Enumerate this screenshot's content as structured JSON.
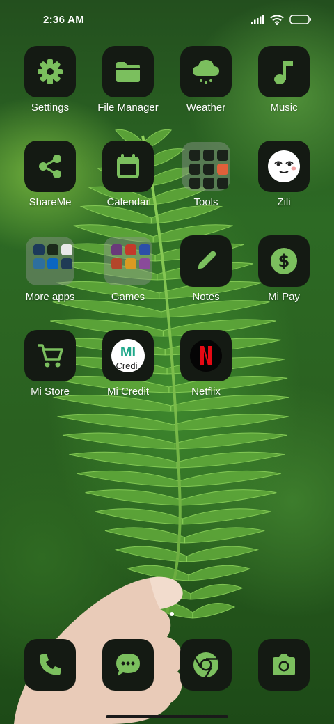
{
  "status_bar": {
    "time": "2:36 AM",
    "icons": [
      "signal-icon",
      "wifi-icon",
      "battery-icon"
    ]
  },
  "theme": {
    "tile_bg": "#141a13",
    "icon_green": "#7bbf5e",
    "label": "#ffffff"
  },
  "apps": [
    {
      "label": "Settings",
      "icon": "gear-icon"
    },
    {
      "label": "File Manager",
      "icon": "folder-icon"
    },
    {
      "label": "Weather",
      "icon": "rain-cloud-icon"
    },
    {
      "label": "Music",
      "icon": "music-note-icon"
    },
    {
      "label": "ShareMe",
      "icon": "share-icon"
    },
    {
      "label": "Calendar",
      "icon": "calendar-icon"
    },
    {
      "label": "Tools",
      "icon": "folder-grid-icon"
    },
    {
      "label": "Zili",
      "icon": "smiley-face-icon"
    },
    {
      "label": "More apps",
      "icon": "folder-grid-icon"
    },
    {
      "label": "Games",
      "icon": "folder-grid-icon"
    },
    {
      "label": "Notes",
      "icon": "pencil-icon"
    },
    {
      "label": "Mi Pay",
      "icon": "dollar-icon"
    },
    {
      "label": "Mi Store",
      "icon": "cart-icon"
    },
    {
      "label": "Mi Credit",
      "icon": "mi-credit-logo-icon",
      "logo_text": "Mi Credit"
    },
    {
      "label": "Netflix",
      "icon": "netflix-logo-icon"
    }
  ],
  "dock": [
    {
      "icon": "phone-icon"
    },
    {
      "icon": "messages-icon"
    },
    {
      "icon": "chrome-icon"
    },
    {
      "icon": "camera-icon"
    }
  ]
}
